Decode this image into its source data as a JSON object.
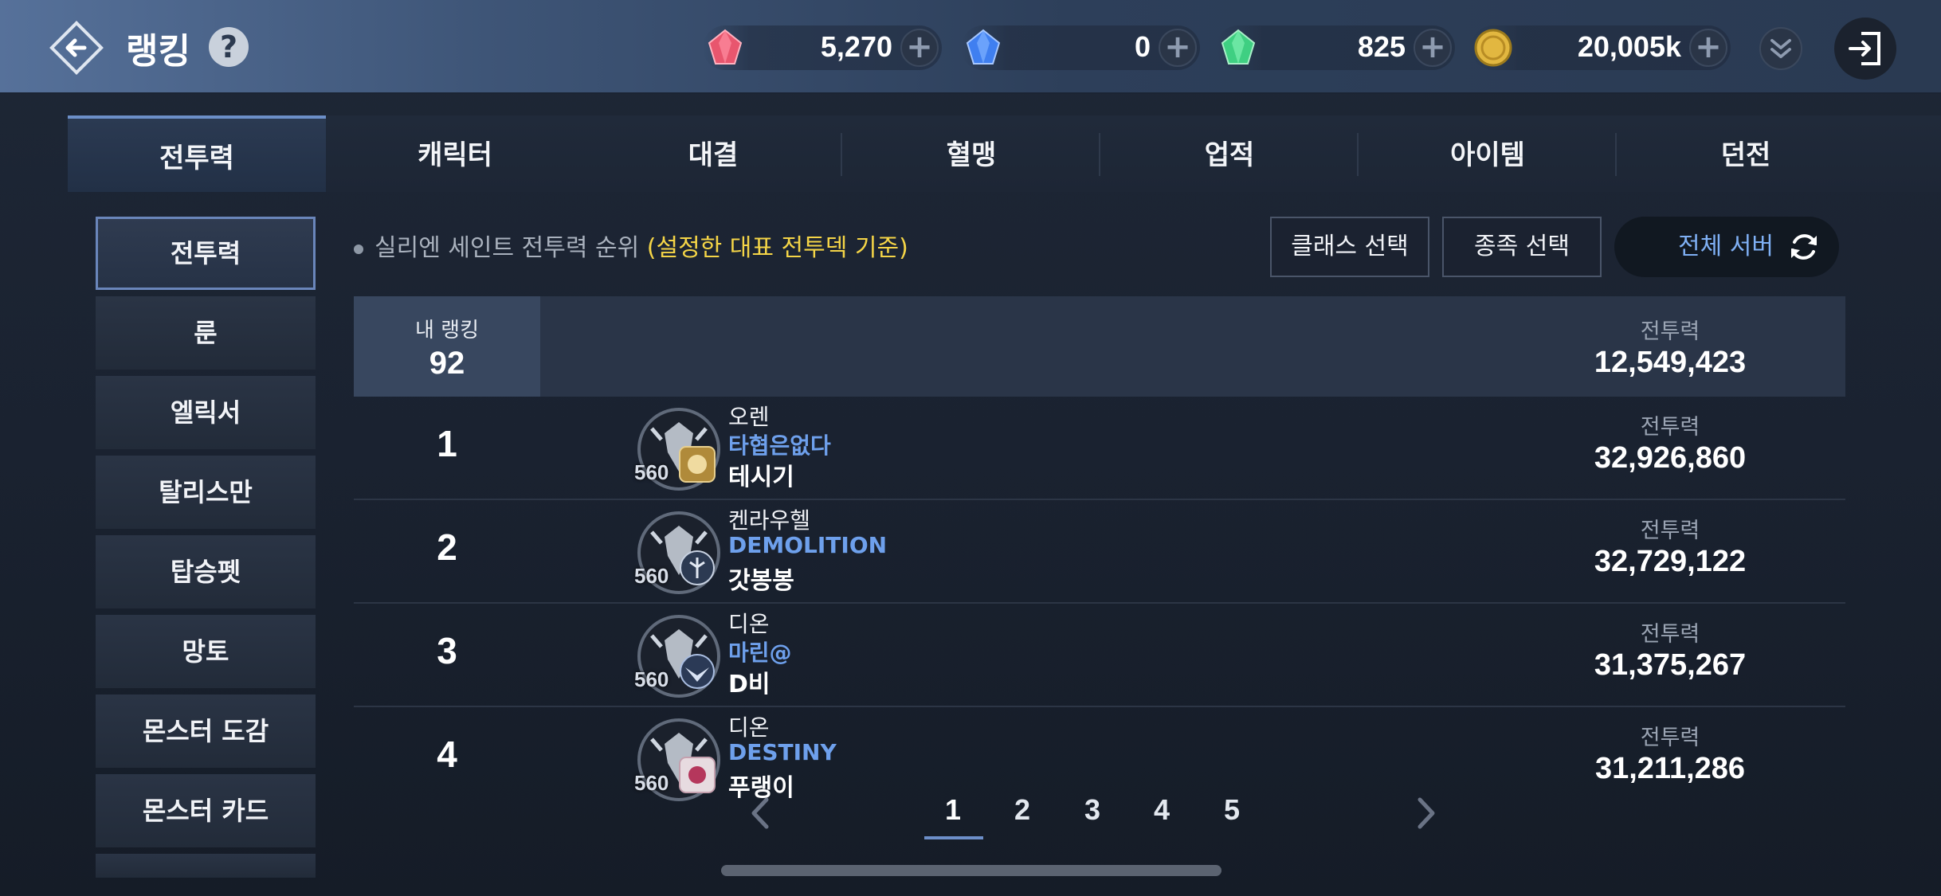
{
  "header": {
    "title": "랭킹",
    "help_label": "?",
    "currencies": [
      {
        "icon": "red-gem-icon",
        "value": "5,270",
        "color": "#e8566e"
      },
      {
        "icon": "blue-gem-icon",
        "value": "0",
        "color": "#3f7ff0"
      },
      {
        "icon": "green-gem-icon",
        "value": "825",
        "color": "#3fcf82"
      },
      {
        "icon": "gold-coin-icon",
        "value": "20,005k",
        "color": "#e2b740"
      }
    ],
    "plus_label": "+"
  },
  "tabs": [
    "전투력",
    "캐릭터",
    "대결",
    "혈맹",
    "업적",
    "아이템",
    "던전"
  ],
  "active_tab": "전투력",
  "sidebar": {
    "items": [
      "전투력",
      "룬",
      "엘릭서",
      "탈리스만",
      "탑승펫",
      "망토",
      "몬스터 도감",
      "몬스터 카드"
    ],
    "active": "전투력"
  },
  "filter": {
    "notice_main": "실리엔 세인트 전투력 순위",
    "notice_highlight": "(설정한 대표 전투덱 기준)",
    "class_select": "클래스 선택",
    "race_select": "종족 선택",
    "server_select": "전체 서버"
  },
  "my_ranking": {
    "label": "내 랭킹",
    "rank": "92",
    "power_label": "전투력",
    "power": "12,549,423"
  },
  "rows": [
    {
      "rank": "1",
      "level": "560",
      "server": "오렌",
      "guild": "타협은없다",
      "name": "테시기",
      "power_label": "전투력",
      "power": "32,926,860",
      "badge": "lion-emblem-icon"
    },
    {
      "rank": "2",
      "level": "560",
      "server": "켄라우헬",
      "guild": "DEMOLITION",
      "name": "갓봉봉",
      "power_label": "전투력",
      "power": "32,729,122",
      "badge": "axe-emblem-icon"
    },
    {
      "rank": "3",
      "level": "560",
      "server": "디온",
      "guild": "마린@",
      "name": "D비",
      "power_label": "전투력",
      "power": "31,375,267",
      "badge": "eagle-emblem-icon"
    },
    {
      "rank": "4",
      "level": "560",
      "server": "디온",
      "guild": "DESTINY",
      "name": "푸랭이",
      "power_label": "전투력",
      "power": "31,211,286",
      "badge": "rose-emblem-icon"
    }
  ],
  "pagination": {
    "pages": [
      "1",
      "2",
      "3",
      "4",
      "5"
    ],
    "current": "1"
  }
}
